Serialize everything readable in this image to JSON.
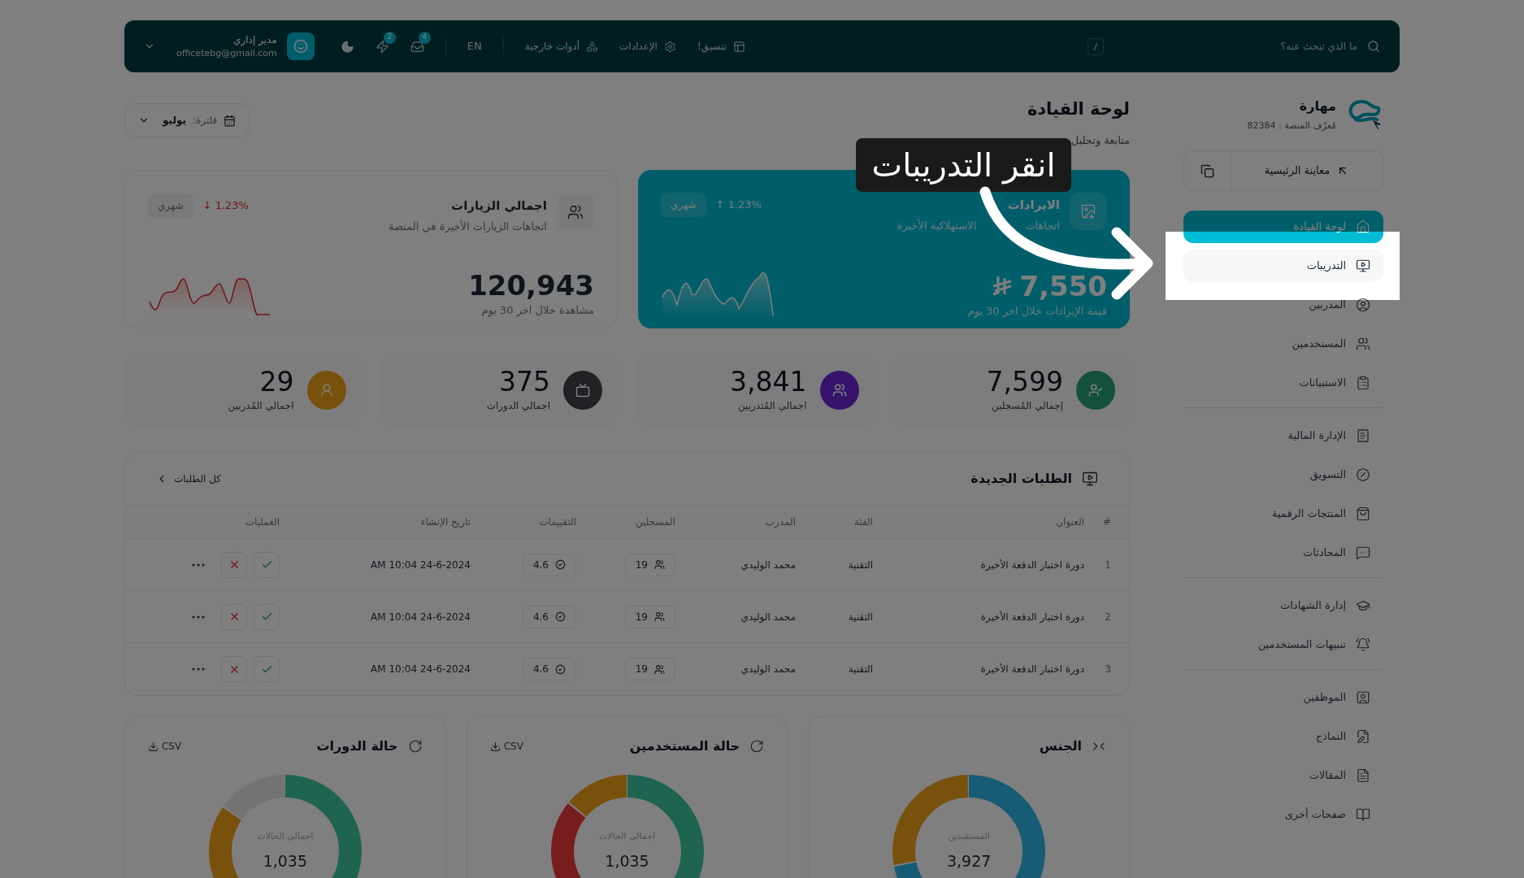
{
  "topbar": {
    "search": {
      "placeholder": "ما الذي تبحث عنه؟",
      "shortcut": "/"
    },
    "links": [
      {
        "label": "تنسيق!",
        "kind": "layout"
      },
      {
        "label": "الإعدادات",
        "kind": "settings"
      },
      {
        "label": "أدوات خارجية",
        "kind": "tools"
      }
    ],
    "language": "EN",
    "notifications": [
      {
        "kind": "inbox",
        "count": "4"
      },
      {
        "kind": "bolt",
        "count": "2"
      }
    ],
    "user": {
      "name": "مدير إداري",
      "email": "officetebg@gmail.com"
    }
  },
  "brand": {
    "name": "مهارة",
    "platform_id": "مُعرّف المنصة : 82384"
  },
  "preview_button": "معاينة الرئيسية",
  "sidebar": {
    "sections": [
      {
        "items": [
          {
            "label": "لوحة القيادة",
            "kind": "home",
            "selected": true,
            "highlighted": false
          },
          {
            "label": "التدريبات",
            "kind": "training",
            "selected": false,
            "highlighted": true
          },
          {
            "label": "المدربين",
            "kind": "trainer",
            "selected": false,
            "highlighted": false
          },
          {
            "label": "المستخدمين",
            "kind": "users",
            "selected": false,
            "highlighted": false
          },
          {
            "label": "الاستبيانات",
            "kind": "survey",
            "selected": false,
            "highlighted": false
          }
        ]
      },
      {
        "items": [
          {
            "label": "الإدارة المالية",
            "kind": "finance",
            "selected": false,
            "highlighted": false
          },
          {
            "label": "التسويق",
            "kind": "marketing",
            "selected": false,
            "highlighted": false
          },
          {
            "label": "المنتجات الرقمية",
            "kind": "products",
            "selected": false,
            "highlighted": false
          },
          {
            "label": "المحادثات",
            "kind": "chat",
            "selected": false,
            "highlighted": false
          }
        ]
      },
      {
        "items": [
          {
            "label": "إدارة الشهادات",
            "kind": "certificates",
            "selected": false,
            "highlighted": false
          },
          {
            "label": "تنبيهات المستخدمين",
            "kind": "alerts",
            "selected": false,
            "highlighted": false
          }
        ]
      },
      {
        "items": [
          {
            "label": "الموظفين",
            "kind": "staff",
            "selected": false,
            "highlighted": false
          },
          {
            "label": "النماذج",
            "kind": "forms",
            "selected": false,
            "highlighted": false
          },
          {
            "label": "المقالات",
            "kind": "articles",
            "selected": false,
            "highlighted": false
          },
          {
            "label": "صفحات أخرى",
            "kind": "pages",
            "selected": false,
            "highlighted": false
          }
        ]
      }
    ]
  },
  "header": {
    "title": "لوحة القيادة",
    "subtitle": "متابعة وتحليل",
    "filter": {
      "label": "فلترة:",
      "value": "يوليو"
    }
  },
  "summary_cards": [
    {
      "kind": "revenue",
      "title": "الايرادات",
      "subtitle_parts": [
        "اتجاهات",
        "الاستهلاكية الأخيرة"
      ],
      "value": "7,550",
      "caption": "قيمة الإيرادات خلال اخر 30 يوم",
      "arrow": "↑",
      "change": "1.23%",
      "period": "شهري"
    },
    {
      "kind": "visits",
      "title": "اجمالي الزيارات",
      "subtitle": "اتجاهات الزيارات الأخيرة في المنصة",
      "value": "120,943",
      "caption": "مشاهدة خلال اخر 30 يوم",
      "arrow": "↓",
      "change": "1.23%",
      "period": "شهري"
    }
  ],
  "stats": [
    {
      "kind": "enrolled",
      "value": "7,599",
      "label": "إجمالي المُسجلين"
    },
    {
      "kind": "trainees",
      "value": "3,841",
      "label": "اجمالي المُتدربين"
    },
    {
      "kind": "courses",
      "value": "375",
      "label": "اجمالي الدورات"
    },
    {
      "kind": "trainers",
      "value": "29",
      "label": "اجمالي المُدربين"
    }
  ],
  "requests_table": {
    "title": "الطلبات الجديدة",
    "link": "كل الطلبات",
    "columns": [
      "#",
      "العنوان",
      "الفئة",
      "المدرب",
      "المسجلين",
      "التقييمات",
      "تاريخ الإنشاء",
      "العمليات"
    ],
    "rows": [
      {
        "index": "1",
        "title": "دورة اختبار الدفعة الأخيرة",
        "category": "التقنية",
        "trainer": "محمد الوليدي",
        "enrolled": "19",
        "rating": "4.6",
        "created": "24-6-2024 10:04 AM"
      },
      {
        "index": "2",
        "title": "دورة اختبار الدفعة الأخيرة",
        "category": "التقنية",
        "trainer": "محمد الوليدي",
        "enrolled": "19",
        "rating": "4.6",
        "created": "24-6-2024 10:04 AM"
      },
      {
        "index": "3",
        "title": "دورة اختبار الدفعة الأخيرة",
        "category": "التقنية",
        "trainer": "محمد الوليدي",
        "enrolled": "19",
        "rating": "4.6",
        "created": "24-6-2024 10:04 AM"
      }
    ]
  },
  "charts": [
    {
      "kind": "gender",
      "title": "الجنس",
      "center_label": "المستفيدين",
      "total": "3,927"
    },
    {
      "kind": "users",
      "title": "حالة المستخدمين",
      "export": "CSV",
      "center_label": "اجمالي الحالات",
      "total": "1,035"
    },
    {
      "kind": "courses",
      "title": "حالة الدورات",
      "export": "CSV",
      "center_label": "اجمالي الحالات",
      "total": "1,035"
    }
  ],
  "tour": {
    "text": "انقر التدريبات"
  }
}
